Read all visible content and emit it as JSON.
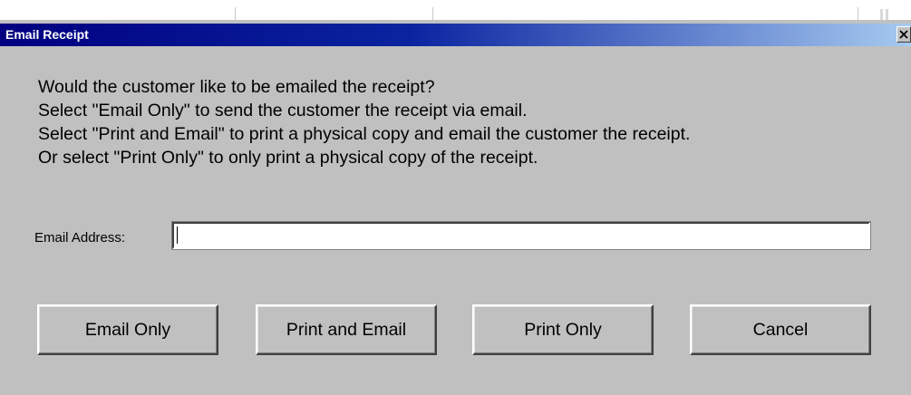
{
  "dialog": {
    "title": "Email Receipt",
    "close_glyph": "×",
    "message_lines": [
      "Would the customer like to be emailed the receipt?",
      "Select \"Email Only\" to send the customer the receipt via email.",
      "Select \"Print and Email\" to print a physical copy and email the customer the receipt.",
      "Or select \"Print Only\" to only print a physical copy of the receipt."
    ],
    "email_label": "Email Address:",
    "email_value": "",
    "buttons": {
      "email_only": "Email Only",
      "print_and_email": "Print and Email",
      "print_only": "Print Only",
      "cancel": "Cancel"
    }
  },
  "colors": {
    "titlebar_start": "#000080",
    "titlebar_end": "#a6caf0",
    "face": "#c0c0c0"
  }
}
